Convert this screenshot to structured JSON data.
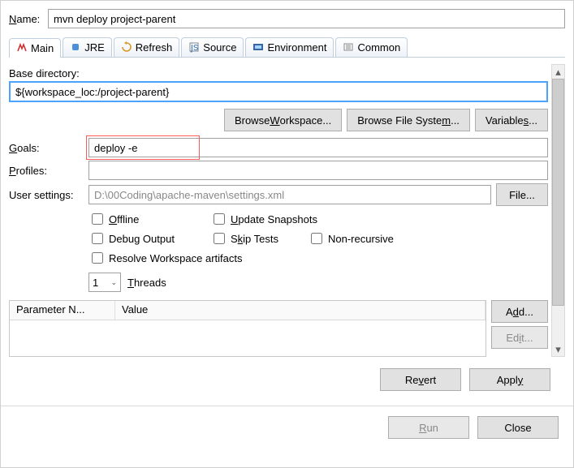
{
  "name_label": "Name:",
  "name_value": "mvn deploy project-parent",
  "tabs": [
    "Main",
    "JRE",
    "Refresh",
    "Source",
    "Environment",
    "Common"
  ],
  "base_dir_label": "Base directory:",
  "base_dir_value": "${workspace_loc:/project-parent}",
  "browse_workspace": "Browse Workspace...",
  "browse_filesystem": "Browse File System...",
  "variables": "Variables...",
  "goals_label": "Goals:",
  "goals_value": "deploy -e",
  "profiles_label": "Profiles:",
  "profiles_value": "",
  "user_settings_label": "User settings:",
  "user_settings_value": "D:\\00Coding\\apache-maven\\settings.xml",
  "file_btn": "File...",
  "checks": {
    "offline": "Offline",
    "update_snapshots": "Update Snapshots",
    "debug_output": "Debug Output",
    "skip_tests": "Skip Tests",
    "non_recursive": "Non-recursive",
    "resolve_workspace": "Resolve Workspace artifacts"
  },
  "threads_value": "1",
  "threads_label": "Threads",
  "table": {
    "col1": "Parameter N...",
    "col2": "Value"
  },
  "add_btn": "Add...",
  "edit_btn": "Edit...",
  "revert_btn": "Revert",
  "apply_btn": "Apply",
  "run_btn": "Run",
  "close_btn": "Close"
}
